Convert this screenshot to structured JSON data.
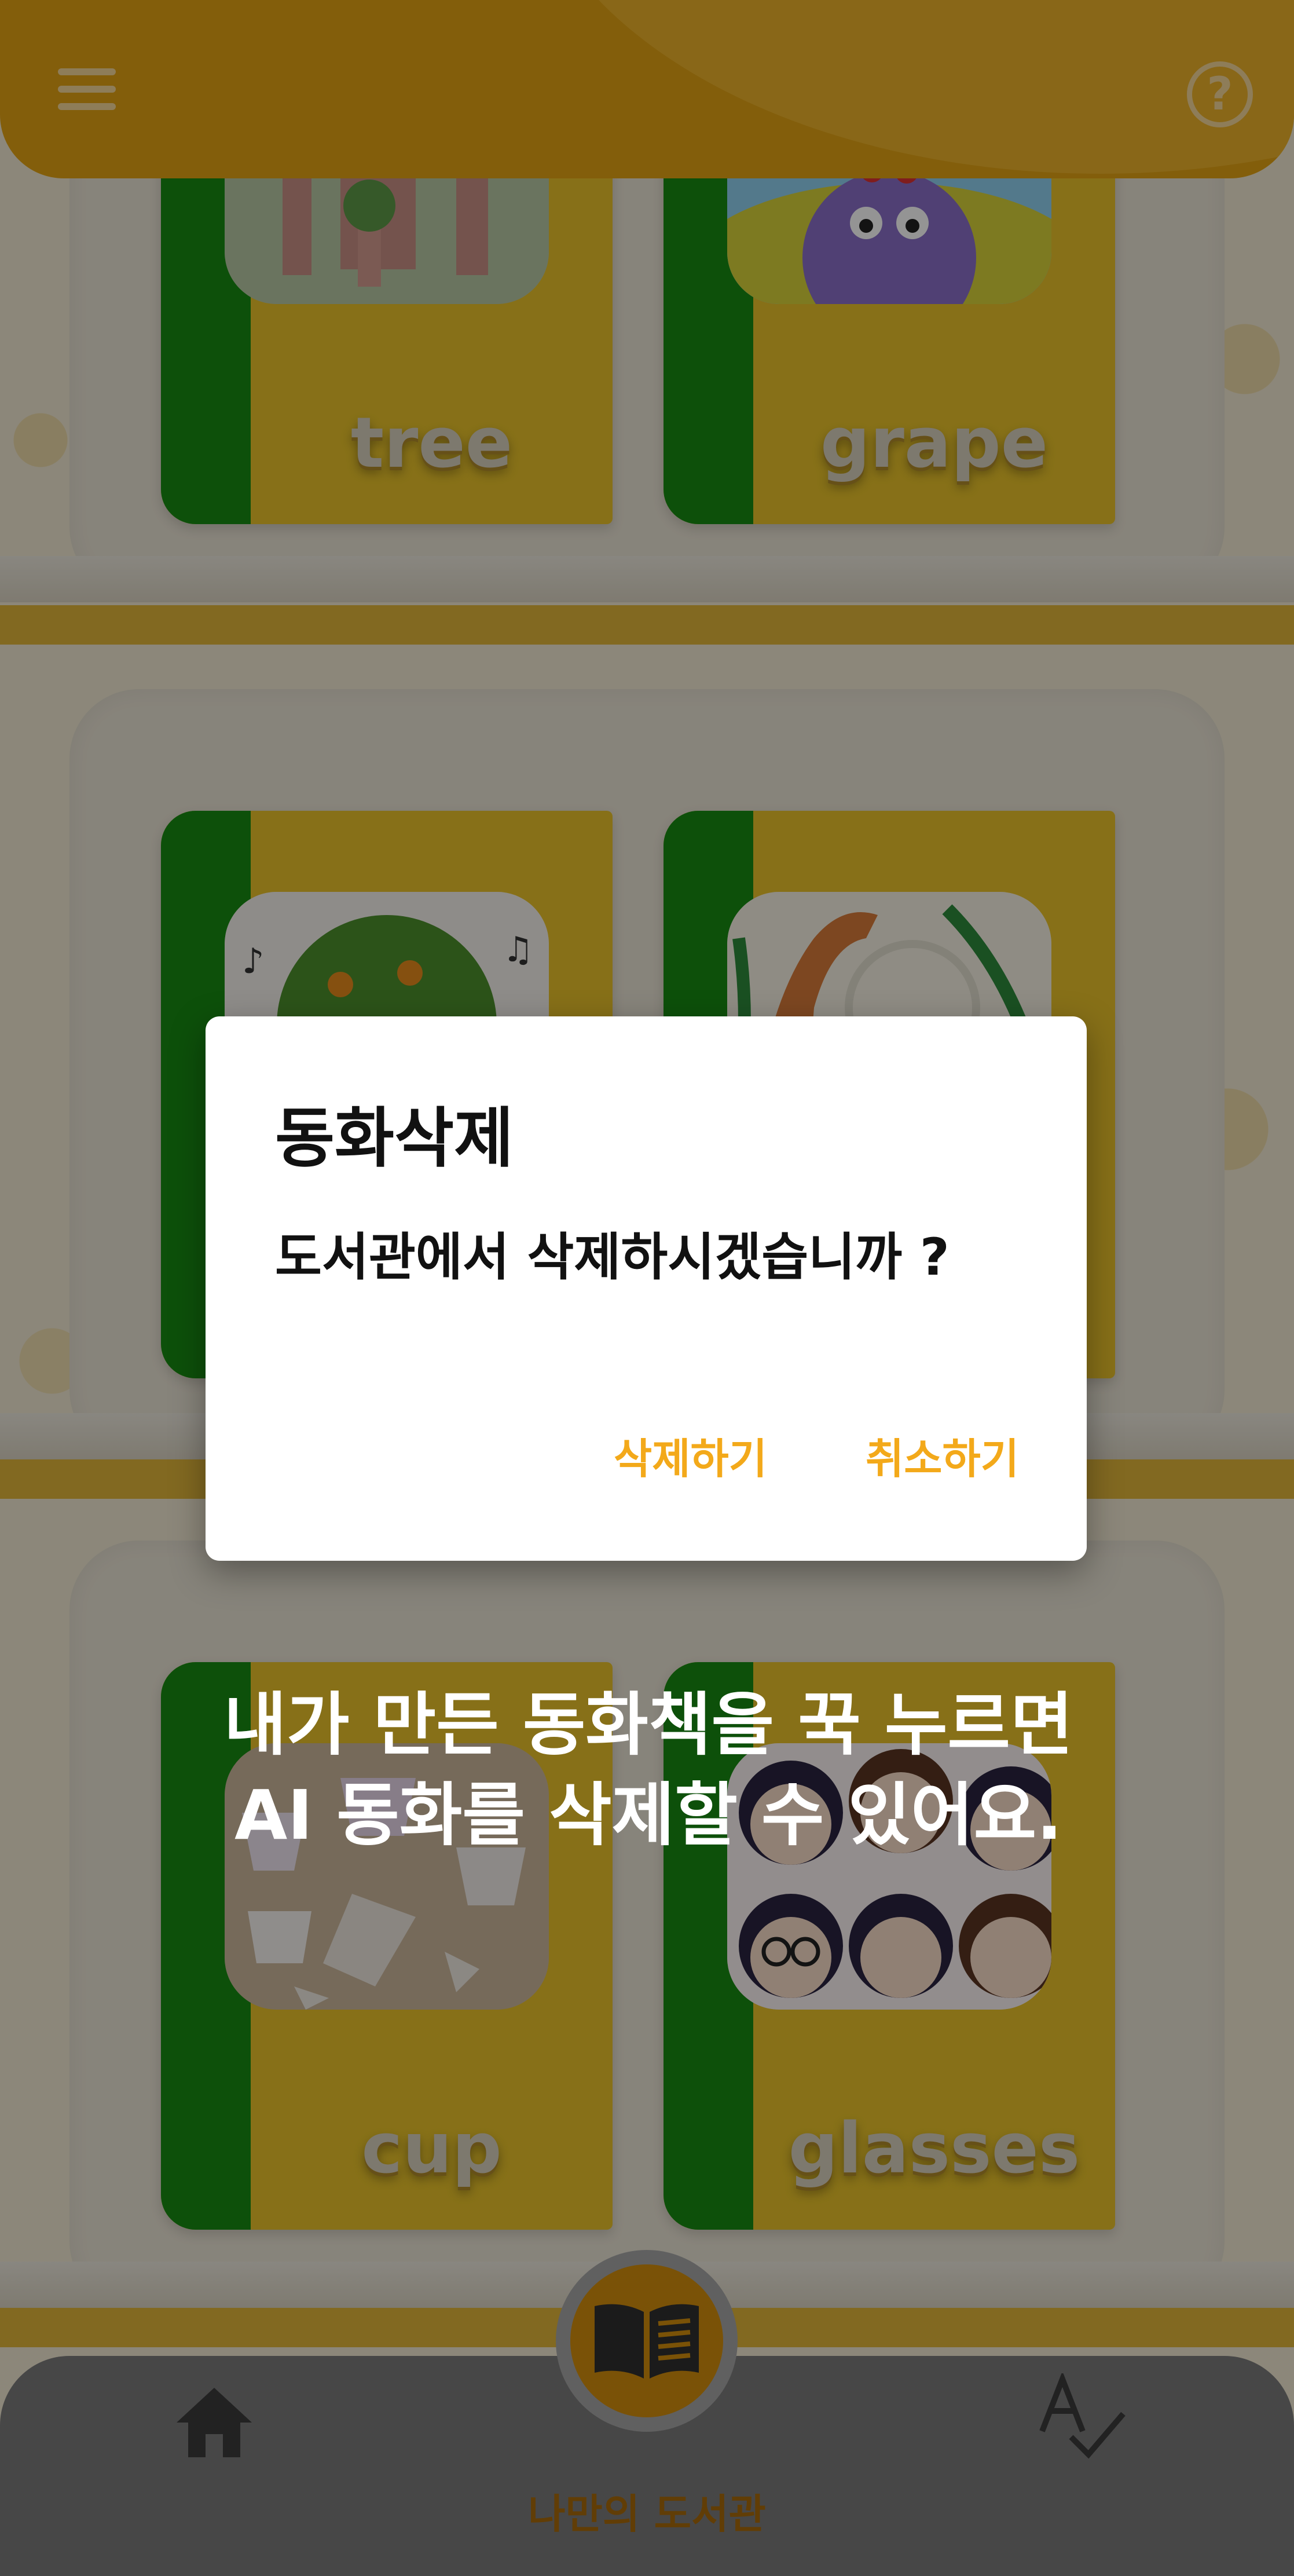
{
  "header": {
    "menu_icon": "hamburger-menu-icon",
    "help_icon": "question-circle-icon",
    "help_glyph": "?"
  },
  "books": [
    {
      "title": "tree"
    },
    {
      "title": "grape"
    },
    {
      "title": ""
    },
    {
      "title": ""
    },
    {
      "title": "cup"
    },
    {
      "title": "glasses"
    }
  ],
  "overlay_hint": {
    "line1": "내가 만든 동화책을 꾹 누르면",
    "line2": "AI 동화를 삭제할 수 있어요."
  },
  "dialog": {
    "title": "동화삭제",
    "message": "도서관에서 삭제하시겠습니까 ?",
    "confirm_label": "삭제하기",
    "cancel_label": "취소하기"
  },
  "bottom_nav": {
    "home_icon": "home-icon",
    "library_icon": "open-book-icon",
    "library_label": "나만의 도서관",
    "spell_icon": "spell-check-icon"
  },
  "colors": {
    "header": "#e2a313",
    "accent": "#f3a91a",
    "book_spine": "#188a12",
    "book_cover": "#e8c22a"
  }
}
